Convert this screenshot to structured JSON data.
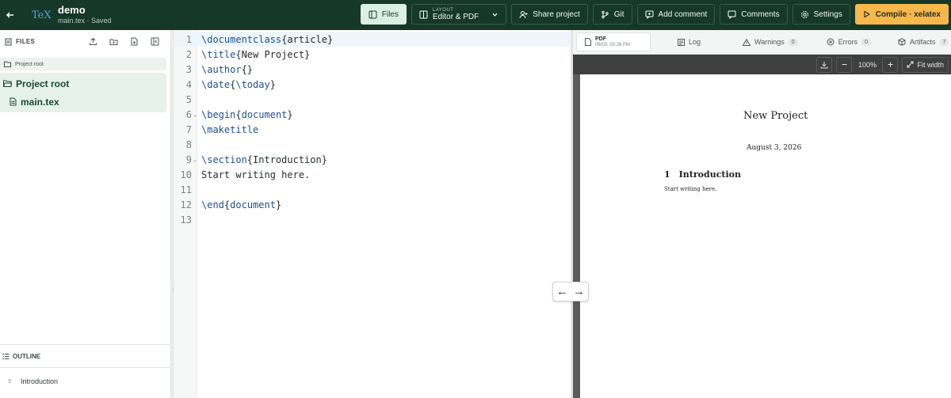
{
  "header": {
    "project_name": "demo",
    "project_subtitle": "main.tex · Saved",
    "logo_text": "TeX",
    "buttons": {
      "files": "Files",
      "layout_label": "LAYOUT",
      "layout_value": "Editor & PDF",
      "share": "Share project",
      "git": "Git",
      "add_comment": "Add comment",
      "comments": "Comments",
      "settings": "Settings",
      "compile": "Compile · xelatex"
    }
  },
  "files_panel": {
    "title": "FILES",
    "breadcrumb": "Project root",
    "tree": [
      {
        "label": "Project root",
        "type": "folder"
      },
      {
        "label": "main.tex",
        "type": "file"
      }
    ]
  },
  "outline": {
    "title": "OUTLINE",
    "items": [
      {
        "line": "9",
        "label": "Introduction"
      }
    ]
  },
  "editor": {
    "lines": [
      {
        "n": "1",
        "parts": [
          [
            "cmd",
            "\\documentclass"
          ],
          [
            "arg",
            "{article}"
          ]
        ],
        "fold": ""
      },
      {
        "n": "2",
        "parts": [
          [
            "cmd",
            "\\title"
          ],
          [
            "arg",
            "{New Project}"
          ]
        ],
        "fold": ""
      },
      {
        "n": "3",
        "parts": [
          [
            "cmd",
            "\\author"
          ],
          [
            "arg",
            "{}"
          ]
        ],
        "fold": ""
      },
      {
        "n": "4",
        "parts": [
          [
            "cmd",
            "\\date"
          ],
          [
            "arg",
            "{"
          ],
          [
            "cmd",
            "\\today"
          ],
          [
            "arg",
            "}"
          ]
        ],
        "fold": ""
      },
      {
        "n": "5",
        "parts": [],
        "fold": ""
      },
      {
        "n": "6",
        "parts": [
          [
            "cmd",
            "\\begin"
          ],
          [
            "arg",
            "{"
          ],
          [
            "cmd",
            "document"
          ],
          [
            "arg",
            "}"
          ]
        ],
        "fold": "⌄"
      },
      {
        "n": "7",
        "parts": [
          [
            "cmd",
            "\\maketitle"
          ]
        ],
        "fold": ""
      },
      {
        "n": "8",
        "parts": [],
        "fold": ""
      },
      {
        "n": "9",
        "parts": [
          [
            "cmd",
            "\\section"
          ],
          [
            "arg",
            "{Introduction}"
          ]
        ],
        "fold": "⌄"
      },
      {
        "n": "10",
        "parts": [
          [
            "arg",
            "Start writing here."
          ]
        ],
        "fold": ""
      },
      {
        "n": "11",
        "parts": [],
        "fold": ""
      },
      {
        "n": "12",
        "parts": [
          [
            "cmd",
            "\\end"
          ],
          [
            "arg",
            "{"
          ],
          [
            "cmd",
            "document"
          ],
          [
            "arg",
            "}"
          ]
        ],
        "fold": ""
      },
      {
        "n": "13",
        "parts": [],
        "fold": ""
      }
    ]
  },
  "pdf_tabs": {
    "pdf_title": "PDF",
    "pdf_time": "08/03, 03:26 PM",
    "log": "Log",
    "warnings": "Warnings",
    "warnings_count": "0",
    "errors": "Errors",
    "errors_count": "0",
    "artifacts": "Artifacts",
    "artifacts_count": "7"
  },
  "pdf_toolbar": {
    "zoom": "100%",
    "fit_width": "Fit width"
  },
  "pdf_page": {
    "title": "New Project",
    "date": "August 3, 2026",
    "section_number": "1",
    "section_title": "Introduction",
    "body": "Start writing here."
  },
  "pane_toggle": {
    "left_arrow": "←",
    "right_arrow": "→"
  }
}
